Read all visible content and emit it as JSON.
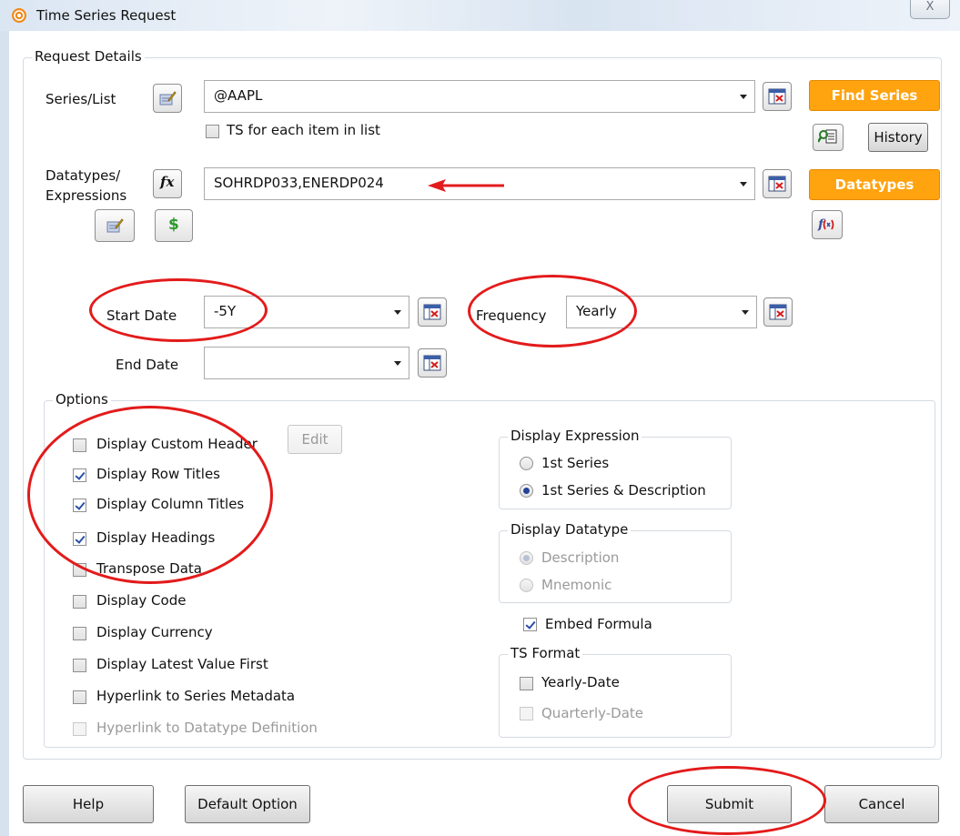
{
  "window": {
    "title": "Time Series Request",
    "close_glyph": "X"
  },
  "request_details": {
    "legend": "Request Details",
    "series_label": "Series/List",
    "series_value": "@AAPL",
    "ts_each_item_label": "TS for each item in list",
    "ts_each_item_checked": false,
    "datatypes_label_line1": "Datatypes/",
    "datatypes_label_line2": "Expressions",
    "datatypes_value": "SOHRDP033,ENERDP024",
    "find_series_label": "Find Series",
    "history_label": "History",
    "datatypes_button_label": "Datatypes",
    "fx_label": "fx",
    "dollar_label": "$",
    "start_date_label": "Start Date",
    "start_date_value": "-5Y",
    "end_date_label": "End Date",
    "end_date_value": "",
    "frequency_label": "Frequency",
    "frequency_value": "Yearly"
  },
  "options": {
    "legend": "Options",
    "edit_label": "Edit",
    "checkboxes": [
      {
        "label": "Display Custom Header",
        "checked": false,
        "enabled": true
      },
      {
        "label": "Display Row Titles",
        "checked": true,
        "enabled": true
      },
      {
        "label": "Display Column Titles",
        "checked": true,
        "enabled": true
      },
      {
        "label": "Display Headings",
        "checked": true,
        "enabled": true
      },
      {
        "label": "Transpose Data",
        "checked": false,
        "enabled": true
      },
      {
        "label": "Display Code",
        "checked": false,
        "enabled": true
      },
      {
        "label": "Display Currency",
        "checked": false,
        "enabled": true
      },
      {
        "label": "Display Latest Value First",
        "checked": false,
        "enabled": true
      },
      {
        "label": "Hyperlink to Series Metadata",
        "checked": false,
        "enabled": true
      },
      {
        "label": "Hyperlink to Datatype Definition",
        "checked": false,
        "enabled": false
      }
    ],
    "display_expression": {
      "legend": "Display Expression",
      "options": [
        "1st Series",
        "1st Series & Description"
      ],
      "selected": "1st Series & Description"
    },
    "display_datatype": {
      "legend": "Display Datatype",
      "options": [
        "Description",
        "Mnemonic"
      ],
      "selected": "Description",
      "enabled": false
    },
    "embed_formula_label": "Embed Formula",
    "embed_formula_checked": true,
    "ts_format": {
      "legend": "TS Format",
      "yearly_date_label": "Yearly-Date",
      "yearly_date_checked": false,
      "quarterly_date_label": "Quarterly-Date",
      "quarterly_date_enabled": false
    }
  },
  "footer": {
    "help_label": "Help",
    "default_option_label": "Default Option",
    "submit_label": "Submit",
    "cancel_label": "Cancel"
  },
  "annotation_color": "#e31b1b",
  "accent_orange": "#ffa30f"
}
